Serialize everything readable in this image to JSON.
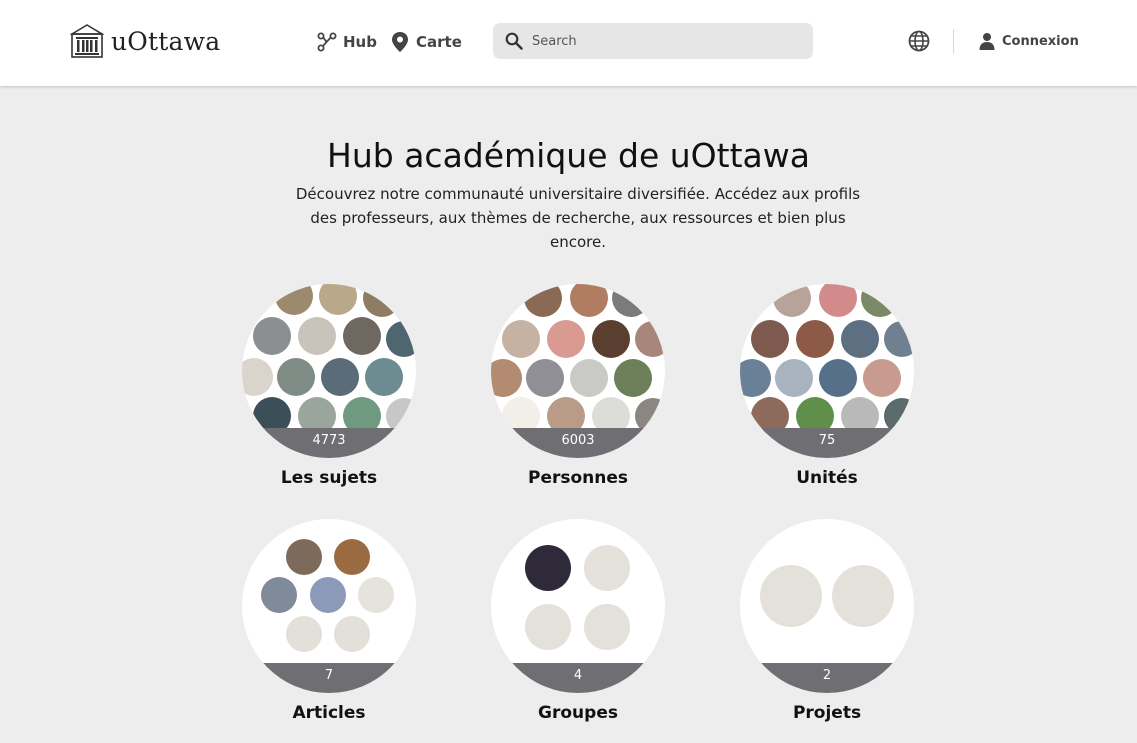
{
  "brand": {
    "name": "uOttawa"
  },
  "nav": {
    "hub_label": "Hub",
    "map_label": "Carte"
  },
  "search": {
    "placeholder": "Search"
  },
  "account": {
    "login_label": "Connexion"
  },
  "hero": {
    "title": "Hub académique de uOttawa",
    "description_line1": "Découvrez notre communauté universitaire diversifiée. Accédez aux profils",
    "description_line2": "des professeurs, aux thèmes de recherche, aux ressources et bien plus encore."
  },
  "categories": [
    {
      "label": "Les sujets",
      "count": "4773"
    },
    {
      "label": "Personnes",
      "count": "6003"
    },
    {
      "label": "Unités",
      "count": "75"
    },
    {
      "label": "Articles",
      "count": "7"
    },
    {
      "label": "Groupes",
      "count": "4"
    },
    {
      "label": "Projets",
      "count": "2"
    }
  ],
  "colors": {
    "header_bg": "#ffffff",
    "page_bg": "#ededed",
    "count_band": "#6e6e73",
    "search_bg": "#e6e6e6"
  },
  "icons": [
    "university-logo-icon",
    "hub-icon",
    "map-pin-icon",
    "search-icon",
    "globe-icon",
    "user-icon"
  ]
}
